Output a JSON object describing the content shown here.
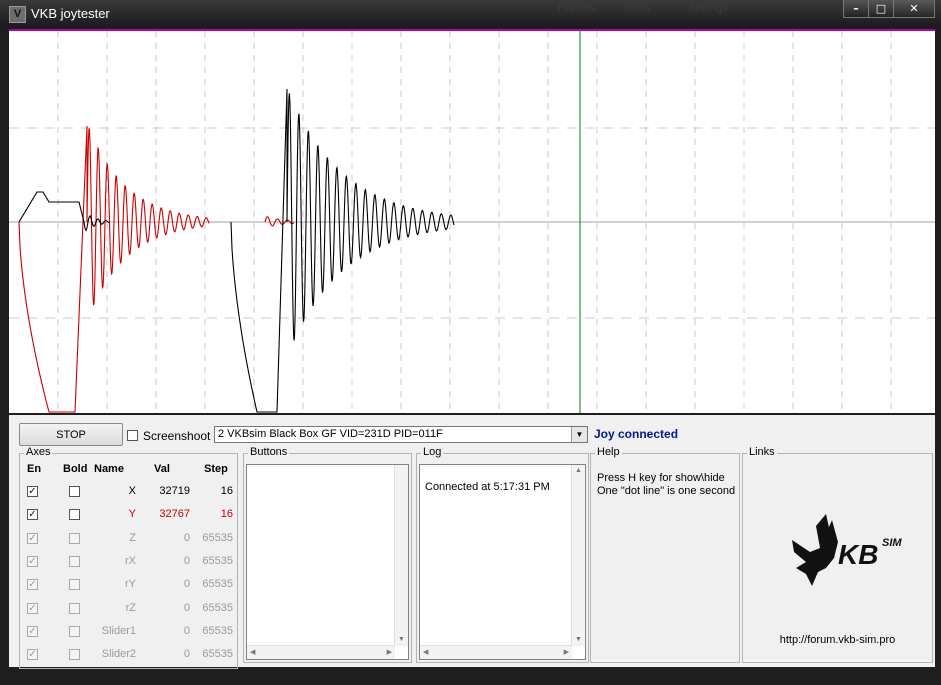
{
  "window": {
    "title": "VKB joytester",
    "icon": "V",
    "bg_menu": [
      "Tools",
      "Settings"
    ],
    "bg_menu_first": "Profiles"
  },
  "controls": {
    "stop_label": "STOP",
    "screenshoot_label": "Screenshoot",
    "device": "2 VKBsim Black Box GF  VID=231D PID=011F",
    "status": "Joy connected",
    "status_color": "#001a8c"
  },
  "axes": {
    "title": "Axes",
    "headers": {
      "en": "En",
      "bold": "Bold",
      "name": "Name",
      "val": "Val",
      "step": "Step"
    },
    "rows": [
      {
        "name": "X",
        "val": "32719",
        "step": "16",
        "enabled": true,
        "bold": false,
        "active": true,
        "color": "#000000"
      },
      {
        "name": "Y",
        "val": "32767",
        "step": "16",
        "enabled": true,
        "bold": false,
        "active": true,
        "color": "#cc0000"
      },
      {
        "name": "Z",
        "val": "0",
        "step": "65535",
        "enabled": true,
        "bold": false,
        "active": false,
        "color": "#9a9a9a"
      },
      {
        "name": "rX",
        "val": "0",
        "step": "65535",
        "enabled": true,
        "bold": false,
        "active": false,
        "color": "#9a9a9a"
      },
      {
        "name": "rY",
        "val": "0",
        "step": "65535",
        "enabled": true,
        "bold": false,
        "active": false,
        "color": "#9a9a9a"
      },
      {
        "name": "rZ",
        "val": "0",
        "step": "65535",
        "enabled": true,
        "bold": false,
        "active": false,
        "color": "#9a9a9a"
      },
      {
        "name": "Slider1",
        "val": "0",
        "step": "65535",
        "enabled": true,
        "bold": false,
        "active": false,
        "color": "#9a9a9a"
      },
      {
        "name": "Slider2",
        "val": "0",
        "step": "65535",
        "enabled": true,
        "bold": false,
        "active": false,
        "color": "#9a9a9a"
      }
    ]
  },
  "buttons_group": {
    "title": "Buttons"
  },
  "log_group": {
    "title": "Log",
    "lines": [
      "Connected at 5:17:31 PM"
    ]
  },
  "help_group": {
    "title": "Help",
    "line1": "Press H key for show\\hide",
    "line2": "One \"dot line\" is one second"
  },
  "links_group": {
    "title": "Links",
    "url": "http://forum.vkb-sim.pro",
    "logo_text": "KB",
    "logo_sup": "SIM"
  },
  "colors": {
    "x_trace": "#000000",
    "y_trace": "#cc0000",
    "cursor": "#008000",
    "top_border": "#b000b0"
  }
}
